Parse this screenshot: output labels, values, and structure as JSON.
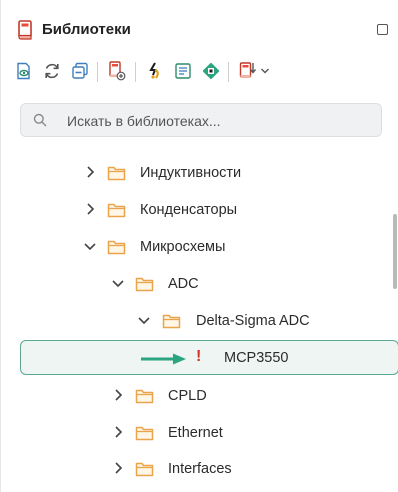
{
  "panel": {
    "title": "Библиотеки",
    "icon": "library-book-icon"
  },
  "toolbar": {
    "buttons": [
      {
        "name": "view-library-icon"
      },
      {
        "name": "refresh-icon"
      },
      {
        "name": "collapse-all-icon"
      },
      {
        "name": "add-library-icon"
      },
      {
        "name": "link-icon"
      },
      {
        "name": "component-properties-icon"
      },
      {
        "name": "chip-icon"
      },
      {
        "name": "import-library-icon"
      },
      {
        "name": "dropdown-chevron-icon"
      }
    ]
  },
  "search": {
    "placeholder": "Искать в библиотеках..."
  },
  "tree": {
    "items": [
      {
        "label": "Индуктивности",
        "expanded": false,
        "level": 0
      },
      {
        "label": "Конденсаторы",
        "expanded": false,
        "level": 0
      },
      {
        "label": "Микросхемы",
        "expanded": true,
        "level": 0
      },
      {
        "label": "ADC",
        "expanded": true,
        "level": 1
      },
      {
        "label": "Delta-Sigma ADC",
        "expanded": true,
        "level": 2
      },
      {
        "label": "MCP3550",
        "level": 3,
        "selected": true,
        "status": "!"
      },
      {
        "label": "CPLD",
        "expanded": false,
        "level": 1
      },
      {
        "label": "Ethernet",
        "expanded": false,
        "level": 1
      },
      {
        "label": "Interfaces",
        "expanded": false,
        "level": 1
      }
    ]
  },
  "colors": {
    "accent": "#2aa57f",
    "folder": "#e9a44c",
    "warning": "#d93025",
    "selection_border": "#5aa894"
  }
}
